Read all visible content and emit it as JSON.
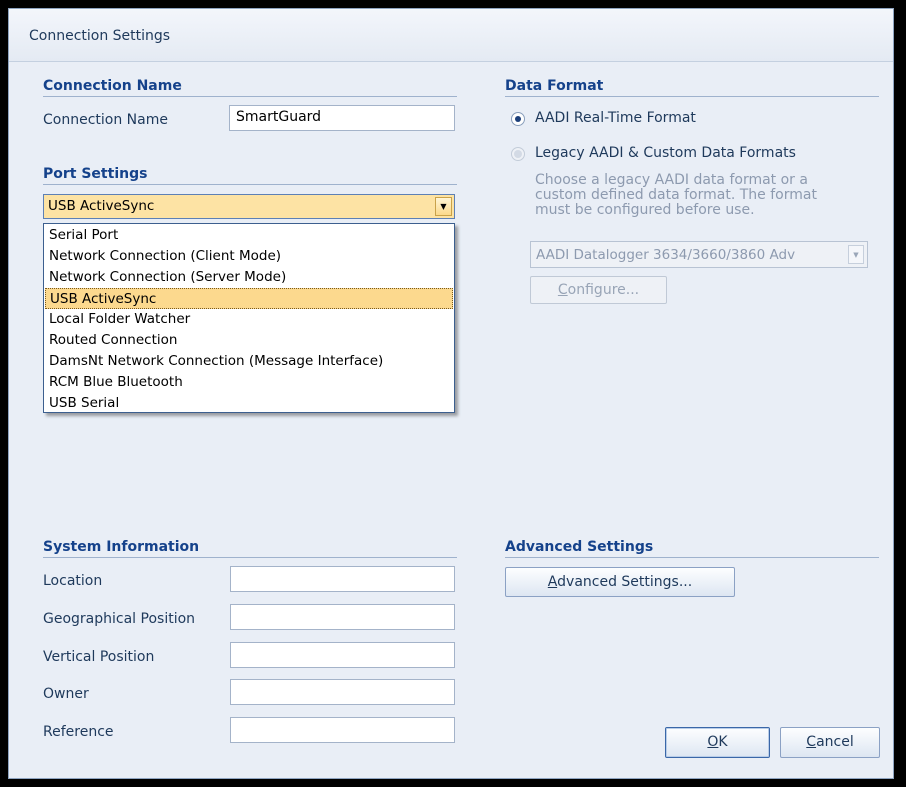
{
  "window": {
    "title": "Connection Settings"
  },
  "connection_name": {
    "header": "Connection Name",
    "label": "Connection Name",
    "value": "SmartGuard"
  },
  "port_settings": {
    "header": "Port Settings",
    "selected": "USB ActiveSync",
    "options": [
      "Serial Port",
      "Network Connection (Client Mode)",
      "Network Connection (Server Mode)",
      "USB ActiveSync",
      "Local Folder Watcher",
      "Routed Connection",
      "DamsNt Network Connection (Message Interface)",
      "RCM Blue Bluetooth",
      "USB Serial"
    ],
    "selected_index": 3
  },
  "data_format": {
    "header": "Data Format",
    "option_realtime": "AADI Real-Time Format",
    "option_legacy": "Legacy AADI & Custom Data Formats",
    "selected": "AADI Real-Time Format",
    "help_text": "Choose a legacy AADI data format or a custom defined data format. The format must be configured before use.",
    "legacy_format_value": "AADI Datalogger 3634/3660/3860 Adv",
    "configure_label_underlined": "C",
    "configure_label_rest": "onfigure..."
  },
  "system_information": {
    "header": "System Information",
    "fields": [
      {
        "label": "Location",
        "value": ""
      },
      {
        "label": "Geographical Position",
        "value": ""
      },
      {
        "label": "Vertical Position",
        "value": ""
      },
      {
        "label": "Owner",
        "value": ""
      },
      {
        "label": "Reference",
        "value": ""
      }
    ]
  },
  "advanced_settings": {
    "header": "Advanced Settings",
    "button_underlined": "A",
    "button_rest": "dvanced Settings..."
  },
  "footer": {
    "ok_underlined": "O",
    "ok_rest": "K",
    "cancel_underlined": "C",
    "cancel_rest": "ancel"
  },
  "colors": {
    "dialog_bg": "#e9eef6",
    "section_header": "#15428b",
    "selection_highlight": "#fcd98e"
  }
}
